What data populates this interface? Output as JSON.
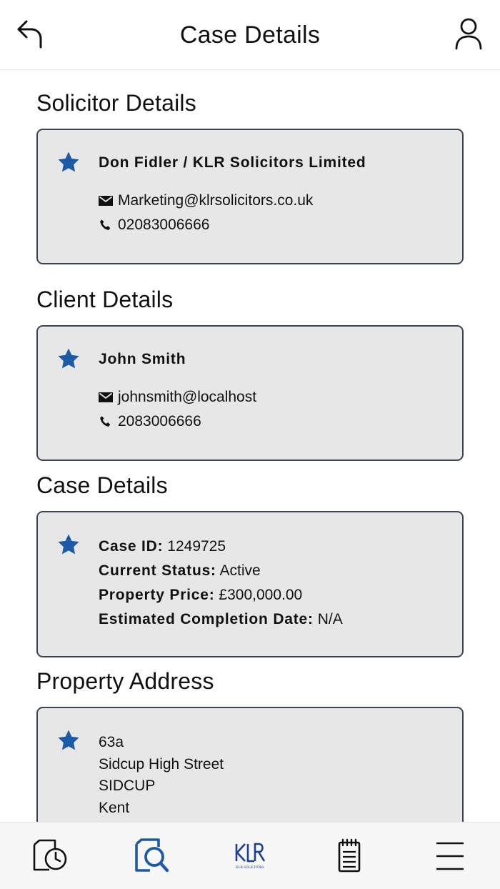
{
  "header": {
    "title": "Case Details",
    "back_icon": "back-arrow-icon",
    "profile_icon": "user-profile-icon"
  },
  "solicitor": {
    "heading": "Solicitor Details",
    "name": "Don Fidler / KLR Solicitors Limited",
    "email": "Marketing@klrsolicitors.co.uk",
    "phone": "02083006666"
  },
  "client": {
    "heading": "Client Details",
    "name": "John Smith",
    "email": "johnsmith@localhost",
    "phone": "2083006666"
  },
  "case": {
    "heading": "Case Details",
    "case_id_label": "Case ID:",
    "case_id": "1249725",
    "status_label": "Current Status:",
    "status": "Active",
    "price_label": "Property Price:",
    "price": "£300,000.00",
    "completion_label": "Estimated Completion Date:",
    "completion": "N/A"
  },
  "property": {
    "heading": "Property Address",
    "lines": [
      "63a",
      "Sidcup High Street",
      "SIDCUP",
      "Kent"
    ]
  },
  "bottom_nav": {
    "items": [
      "document-clock-icon",
      "document-search-icon",
      "klr-logo",
      "notepad-icon",
      "hamburger-menu-icon"
    ],
    "active_index": 1,
    "logo_subtext": "KLR SOLICITORS"
  },
  "colors": {
    "accent": "#1d5aa6",
    "card_bg": "#e7e7e7",
    "card_border": "#3b4456"
  }
}
